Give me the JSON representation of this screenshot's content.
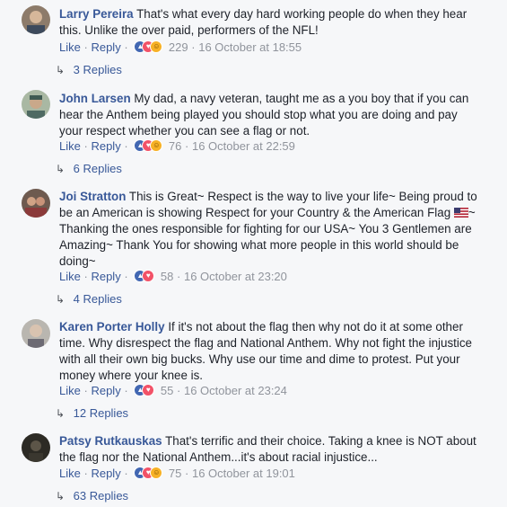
{
  "comments": [
    {
      "author": "Larry Pereira",
      "text": "That's what every day hard working people do when they hear this. Unlike the over paid, performers of the NFL!",
      "like": "Like",
      "reply": "Reply",
      "reaction_count": "229",
      "timestamp": "16 October at 18:55",
      "replies": "3 Replies"
    },
    {
      "author": "John Larsen",
      "text": "My dad, a navy veteran, taught me as a you boy that if you can hear the Anthem being played you should stop what you are doing and pay your respect whether you can see a flag or not.",
      "like": "Like",
      "reply": "Reply",
      "reaction_count": "76",
      "timestamp": "16 October at 22:59",
      "replies": "6 Replies"
    },
    {
      "author": "Joi Stratton",
      "text": "This is Great~ Respect is the way to live your life~ Being proud to be an American is showing Respect for your Country & the American Flag",
      "text_after_flag": "~ Thanking the ones responsible for fighting for our USA~ You 3 Gentlemen are Amazing~ Thank You for showing what more people in this world should be doing~",
      "like": "Like",
      "reply": "Reply",
      "reaction_count": "58",
      "timestamp": "16 October at 23:20",
      "replies": "4 Replies"
    },
    {
      "author": "Karen Porter Holly",
      "text": "If it's not about the flag then why not do it at some other time. Why disrespect the flag and National Anthem. Why not fight the injustice with all their own big bucks. Why use our time and dime to protest. Put your money where your knee is.",
      "like": "Like",
      "reply": "Reply",
      "reaction_count": "55",
      "timestamp": "16 October at 23:24",
      "replies": "12 Replies"
    },
    {
      "author": "Patsy Rutkauskas",
      "text": "That's terrific and their choice. Taking a knee is NOT about the flag nor the National Anthem...it's about racial injustice...",
      "like": "Like",
      "reply": "Reply",
      "reaction_count": "75",
      "timestamp": "16 October at 19:01",
      "replies": "63 Replies"
    }
  ],
  "separator": "·",
  "icons": {
    "reactions": [
      "like-icon",
      "love-icon",
      "haha-icon"
    ],
    "reply_arrow": "reply-arrow-icon",
    "flag": "us-flag-emoji-icon"
  },
  "colors": {
    "author": "#385898",
    "link": "#385898",
    "meta": "#90949c",
    "background": "#f6f7f9"
  }
}
